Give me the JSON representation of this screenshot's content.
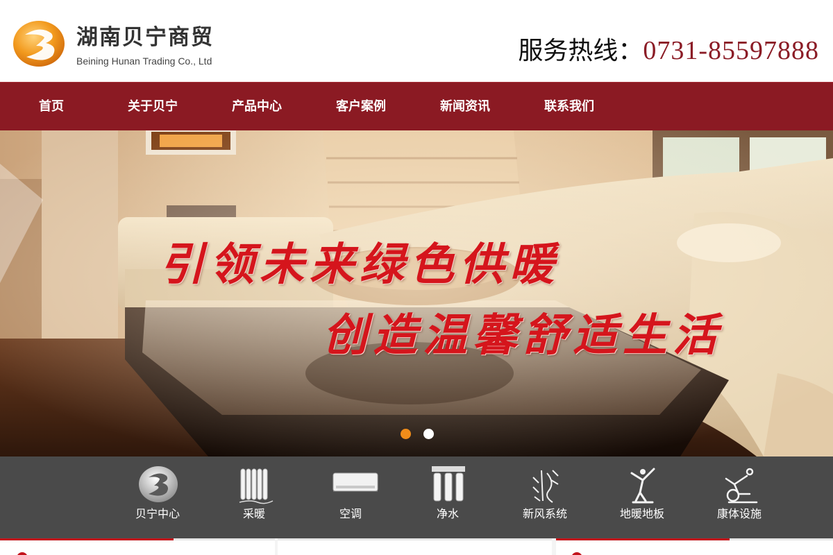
{
  "header": {
    "logo_cn": "湖南贝宁商贸",
    "logo_en": "Beining Hunan Trading Co., Ltd",
    "hotline_label": "服务热线：",
    "hotline_number": "0731-85597888"
  },
  "nav": {
    "items": [
      {
        "label": "首页"
      },
      {
        "label": "关于贝宁"
      },
      {
        "label": "产品中心"
      },
      {
        "label": "客户案例"
      },
      {
        "label": "新闻资讯"
      },
      {
        "label": "联系我们"
      }
    ]
  },
  "banner": {
    "slogan_line1": "引领未来绿色供暖",
    "slogan_line2": "创造温馨舒适生活",
    "active_slide": 1,
    "slide_count": 2
  },
  "categories": [
    {
      "label": "贝宁中心",
      "icon": "beining-logo-icon"
    },
    {
      "label": "采暖",
      "icon": "radiator-icon"
    },
    {
      "label": "空调",
      "icon": "air-conditioner-icon"
    },
    {
      "label": "净水",
      "icon": "water-purifier-icon"
    },
    {
      "label": "新风系统",
      "icon": "fresh-air-icon"
    },
    {
      "label": "地暖地板",
      "icon": "floor-heating-icon"
    },
    {
      "label": "康体设施",
      "icon": "fitness-icon"
    }
  ],
  "colors": {
    "brand_red": "#8b1a23",
    "accent_red": "#c3141c",
    "active_dot": "#f08c1a",
    "category_bar": "#4a4a4a"
  }
}
